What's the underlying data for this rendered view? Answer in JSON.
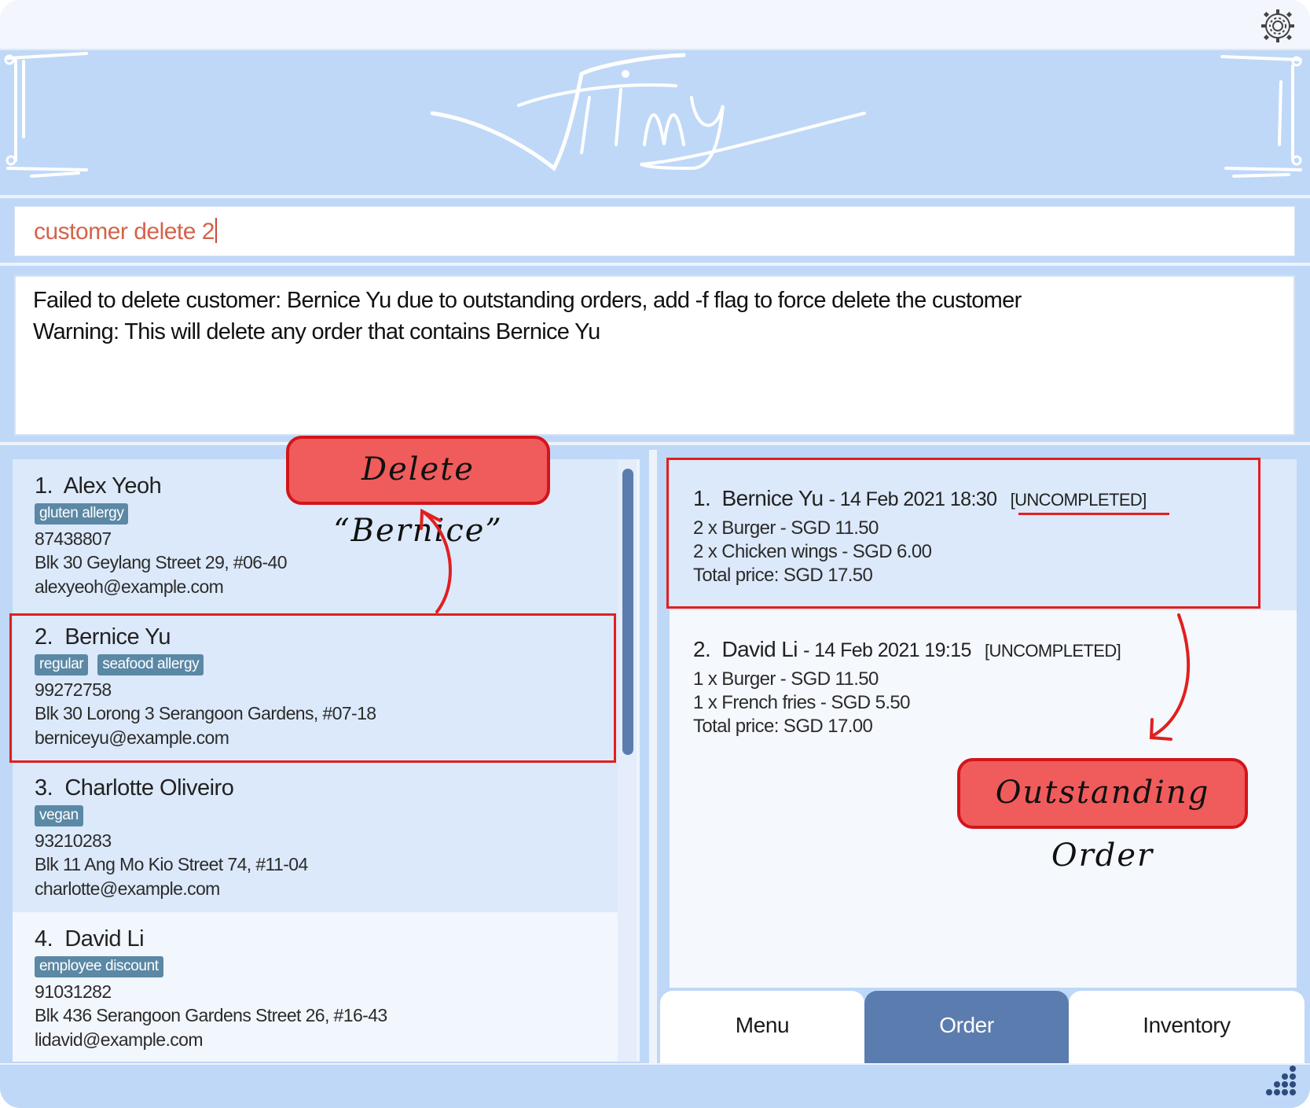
{
  "app": {
    "logo_text": "Jimy",
    "icons": {
      "settings": "gear-icon",
      "resize": "resize-grip-icon"
    }
  },
  "command": {
    "value": "customer delete 2"
  },
  "result": {
    "line1": "Failed to delete customer: Bernice Yu due to outstanding orders, add -f flag to force delete the customer",
    "line2": "Warning: This will delete any order that contains Bernice Yu"
  },
  "customers": [
    {
      "index": "1.",
      "name": "Alex Yeoh",
      "tags": [
        "gluten allergy"
      ],
      "phone": "87438807",
      "address": "Blk 30 Geylang Street 29, #06-40",
      "email": "alexyeoh@example.com"
    },
    {
      "index": "2.",
      "name": "Bernice Yu",
      "tags": [
        "regular",
        "seafood allergy"
      ],
      "phone": "99272758",
      "address": "Blk 30 Lorong 3 Serangoon Gardens, #07-18",
      "email": "berniceyu@example.com"
    },
    {
      "index": "3.",
      "name": "Charlotte Oliveiro",
      "tags": [
        "vegan"
      ],
      "phone": "93210283",
      "address": "Blk 11 Ang Mo Kio Street 74, #11-04",
      "email": "charlotte@example.com"
    },
    {
      "index": "4.",
      "name": "David Li",
      "tags": [
        "employee discount"
      ],
      "phone": "91031282",
      "address": "Blk 436 Serangoon Gardens Street 26, #16-43",
      "email": "lidavid@example.com"
    }
  ],
  "orders": [
    {
      "index": "1.",
      "customer": "Bernice Yu",
      "datetime": "- 14 Feb 2021 18:30",
      "status": "[UNCOMPLETED]",
      "items": [
        "2 x Burger - SGD 11.50",
        "2 x Chicken wings - SGD 6.00"
      ],
      "total": "Total price: SGD 17.50"
    },
    {
      "index": "2.",
      "customer": "David Li",
      "datetime": "- 14 Feb 2021 19:15",
      "status": "[UNCOMPLETED]",
      "items": [
        "1 x Burger - SGD 11.50",
        "1 x French fries - SGD 5.50"
      ],
      "total": "Total price: SGD 17.00"
    }
  ],
  "tabs": [
    {
      "label": "Menu",
      "active": false
    },
    {
      "label": "Order",
      "active": true
    },
    {
      "label": "Inventory",
      "active": false
    }
  ],
  "annotations": {
    "delete_label": "Delete “Bernice”",
    "outstanding_label": "Outstanding Order"
  },
  "colors": {
    "window_bg": "#bfd8f8",
    "accent": "#5b7cae",
    "tag_bg": "#5b88a5",
    "command_text": "#d3634b",
    "annotation_red": "#e0201f",
    "bubble_fill": "#f05b5b"
  }
}
